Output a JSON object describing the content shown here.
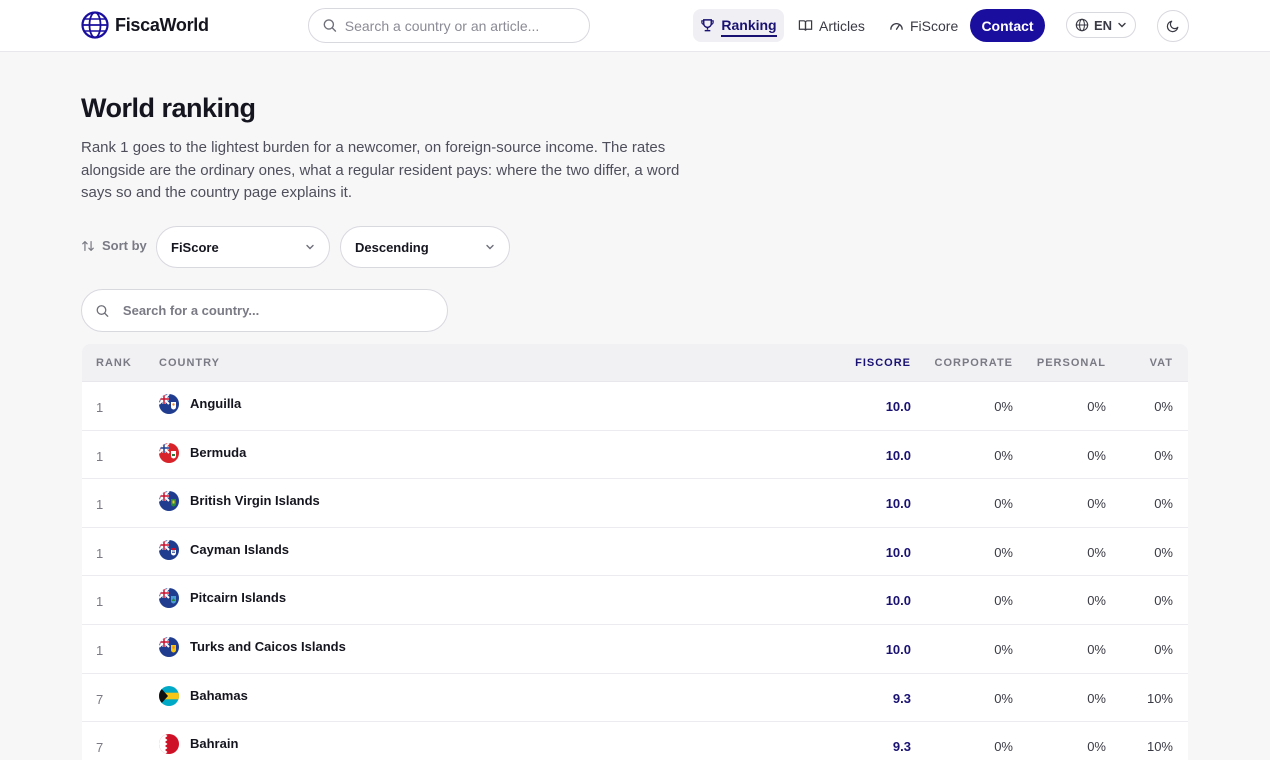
{
  "header": {
    "logo_text": "FiscaWorld",
    "search_placeholder": "Search a country or an article...",
    "nav": [
      {
        "label": "Ranking",
        "icon": "trophy-icon",
        "active": true
      },
      {
        "label": "Articles",
        "icon": "book-icon",
        "active": false
      },
      {
        "label": "FiScore",
        "icon": "gauge-icon",
        "active": false
      }
    ],
    "contact_label": "Contact",
    "language": "EN",
    "accent_color": "#1a0e9e"
  },
  "main": {
    "title": "World ranking",
    "description": "Rank 1 goes to the lightest burden for a newcomer, on foreign-source income. The rates alongside are the ordinary ones, what a regular resident pays: where the two differ, a word says so and the country page explains it.",
    "sort_label": "Sort by",
    "sort_field": "FiScore",
    "sort_order": "Descending",
    "country_search_placeholder": "Search for a country..."
  },
  "table": {
    "columns": [
      "RANK",
      "COUNTRY",
      "FISCORE",
      "CORPORATE",
      "PERSONAL",
      "VAT"
    ],
    "rows": [
      {
        "rank": "1",
        "country": "Anguilla",
        "flag": "anguilla-flag",
        "fiscore": "10.0",
        "corporate": "0%",
        "personal": "0%",
        "vat": "0%"
      },
      {
        "rank": "1",
        "country": "Bermuda",
        "flag": "bermuda-flag",
        "fiscore": "10.0",
        "corporate": "0%",
        "personal": "0%",
        "vat": "0%"
      },
      {
        "rank": "1",
        "country": "British Virgin Islands",
        "flag": "bvi-flag",
        "fiscore": "10.0",
        "corporate": "0%",
        "personal": "0%",
        "vat": "0%"
      },
      {
        "rank": "1",
        "country": "Cayman Islands",
        "flag": "cayman-flag",
        "fiscore": "10.0",
        "corporate": "0%",
        "personal": "0%",
        "vat": "0%"
      },
      {
        "rank": "1",
        "country": "Pitcairn Islands",
        "flag": "pitcairn-flag",
        "fiscore": "10.0",
        "corporate": "0%",
        "personal": "0%",
        "vat": "0%"
      },
      {
        "rank": "1",
        "country": "Turks and Caicos Islands",
        "flag": "turks-caicos-flag",
        "fiscore": "10.0",
        "corporate": "0%",
        "personal": "0%",
        "vat": "0%"
      },
      {
        "rank": "7",
        "country": "Bahamas",
        "flag": "bahamas-flag",
        "fiscore": "9.3",
        "corporate": "0%",
        "personal": "0%",
        "vat": "10%"
      },
      {
        "rank": "7",
        "country": "Bahrain",
        "flag": "bahrain-flag",
        "fiscore": "9.3",
        "corporate": "0%",
        "personal": "0%",
        "vat": "10%"
      }
    ]
  }
}
